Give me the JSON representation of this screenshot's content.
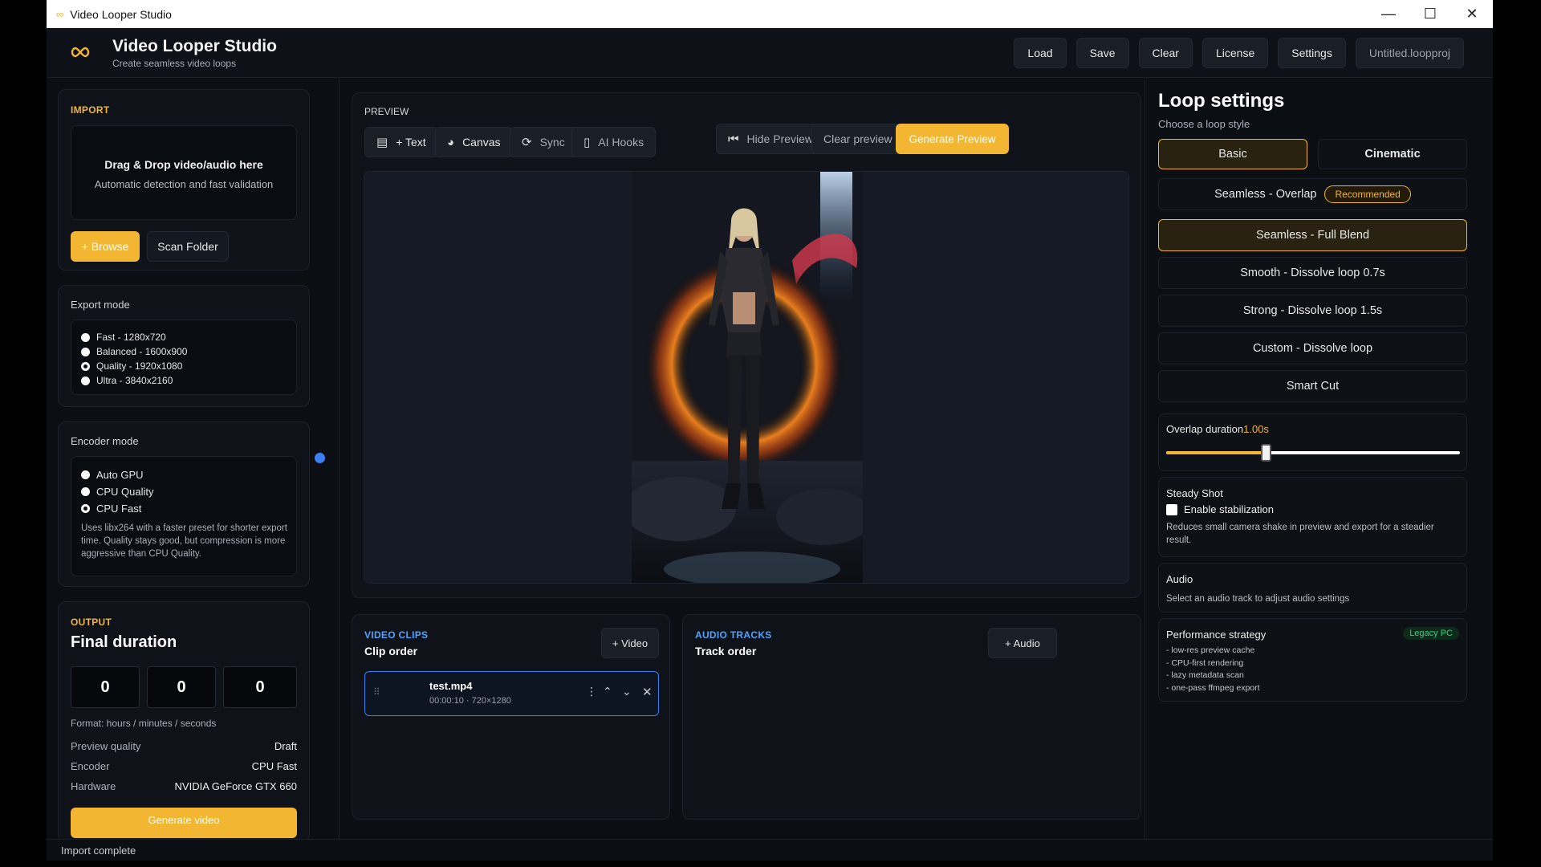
{
  "window": {
    "title": "Video Looper Studio",
    "controls": {
      "minimize": "—",
      "maximize": "☐",
      "close": "✕"
    }
  },
  "header": {
    "title": "Video Looper Studio",
    "subtitle": "Create seamless video loops",
    "buttons": {
      "load": "Load",
      "save": "Save",
      "clear": "Clear",
      "license": "License",
      "settings": "Settings"
    },
    "project_name": "Untitled.loopproj"
  },
  "import": {
    "section": "IMPORT",
    "drop_title": "Drag & Drop video/audio here",
    "drop_sub": "Automatic detection and fast validation",
    "browse": "+ Browse",
    "scan": "Scan Folder"
  },
  "export_mode": {
    "label": "Export mode",
    "options": [
      "Fast - 1280x720",
      "Balanced - 1600x900",
      "Quality - 1920x1080",
      "Ultra - 3840x2160"
    ],
    "selected": "Quality - 1920x1080"
  },
  "encoder_mode": {
    "label": "Encoder mode",
    "options": [
      "Auto GPU",
      "CPU Quality",
      "CPU Fast"
    ],
    "selected": "CPU Fast",
    "description": "Uses libx264 with a faster preset for shorter export time. Quality stays good, but compression is more aggressive than CPU Quality."
  },
  "output": {
    "section": "OUTPUT",
    "title": "Final duration",
    "hours": "0",
    "minutes": "0",
    "seconds": "0",
    "format": "Format: hours / minutes / seconds",
    "preview_quality_label": "Preview quality",
    "preview_quality": "Draft",
    "encoder_label": "Encoder",
    "encoder": "CPU Fast",
    "hardware_label": "Hardware",
    "hardware": "NVIDIA GeForce GTX 660",
    "generate": "Generate video"
  },
  "preview": {
    "section": "PREVIEW",
    "tools": {
      "text": "+ Text",
      "canvas": "Canvas",
      "sync": "Sync",
      "ai_hooks": "AI Hooks"
    },
    "hide": "Hide Preview",
    "clear": "Clear preview",
    "generate": "Generate Preview"
  },
  "video_clips": {
    "section": "VIDEO CLIPS",
    "title": "Clip order",
    "add": "+ Video",
    "clips": [
      {
        "name": "test.mp4",
        "meta": "00:00:10 · 720×1280"
      }
    ]
  },
  "audio_tracks": {
    "section": "AUDIO TRACKS",
    "title": "Track order",
    "add": "+ Audio"
  },
  "loop_settings": {
    "title": "Loop settings",
    "subtitle": "Choose a loop style",
    "tabs": [
      "Basic",
      "Cinematic"
    ],
    "active_tab": "Basic",
    "options": [
      "Seamless - Overlap",
      "Seamless - Full Blend",
      "Smooth - Dissolve loop 0.7s",
      "Strong - Dissolve loop 1.5s",
      "Custom - Dissolve loop",
      "Smart Cut"
    ],
    "recommended": "Recommended",
    "selected": "Seamless - Full Blend",
    "overlap_label": "Overlap duration",
    "overlap_value": "1.00s",
    "overlap_fraction": 0.34
  },
  "steady_shot": {
    "title": "Steady Shot",
    "checkbox": "Enable stabilization",
    "checked": false,
    "description": "Reduces small camera shake in preview and export for a steadier result."
  },
  "audio": {
    "title": "Audio",
    "description": "Select an audio track to adjust audio settings"
  },
  "performance": {
    "title": "Performance strategy",
    "badge": "Legacy PC",
    "items": [
      "- low-res preview cache",
      "- CPU-first rendering",
      "- lazy metadata scan",
      "- one-pass ffmpeg export"
    ]
  },
  "status": {
    "text": "Import complete"
  },
  "colors": {
    "accent": "#f2b632",
    "blue": "#4fa3ff",
    "badge_green": "#35d07f"
  }
}
